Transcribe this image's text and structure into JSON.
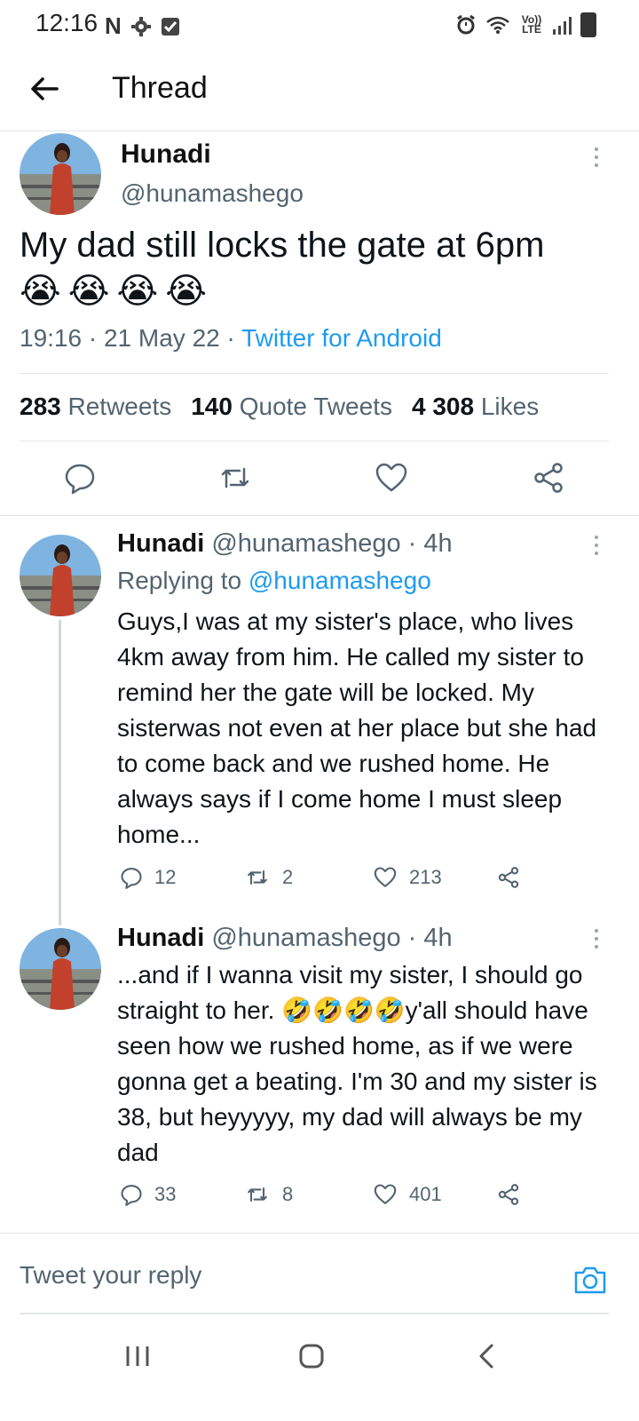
{
  "status_bar": {
    "time": "12:16",
    "n_badge": "N",
    "lte": "Vo)) LTE"
  },
  "header": {
    "title": "Thread"
  },
  "main_tweet": {
    "name": "Hunadi",
    "handle": "@hunamashego",
    "text": "My dad still locks the gate at 6pm",
    "emoji": [
      "😭",
      "😭",
      "😭",
      "😭"
    ],
    "time": "19:16",
    "date": "21 May 22",
    "source": "Twitter for Android",
    "retweets": "283",
    "retweets_label": "Retweets",
    "quotes": "140",
    "quotes_label": "Quote Tweets",
    "likes": "4 308",
    "likes_label": "Likes"
  },
  "replies": [
    {
      "name": "Hunadi",
      "handle": "@hunamashego",
      "age": "· 4h",
      "replying_label": "Replying to",
      "replying_to": "@hunamashego",
      "text": "Guys,I was at my sister's place, who lives 4km away from him. He called my sister to remind her the gate will be locked. My sisterwas not even at her place but she had to come back and we rushed home. He always says if I come home  I must sleep home...",
      "replies": "12",
      "retweets": "2",
      "likes": "213"
    },
    {
      "name": "Hunadi",
      "handle": "@hunamashego",
      "age": "· 4h",
      "text_before": "...and if I wanna visit my sister, I should go straight to her.",
      "emoji": "🤣🤣🤣🤣",
      "text_after": "y'all should have seen how we rushed home, as if we were gonna get a beating. I'm 30 and my sister is 38, but heyyyyy, my dad will always be my dad",
      "replies": "33",
      "retweets": "8",
      "likes": "401"
    }
  ],
  "compose": {
    "placeholder": "Tweet your reply"
  },
  "colors": {
    "accent": "#1d9bf0",
    "text": "#0f1419",
    "secondary": "#536471"
  }
}
